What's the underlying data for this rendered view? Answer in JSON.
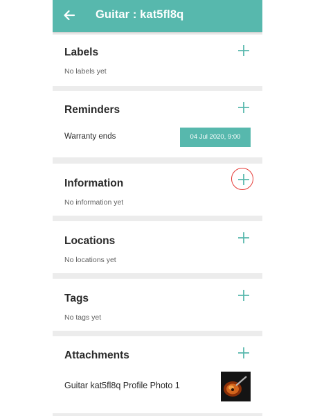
{
  "appbar": {
    "title": "Guitar : kat5fl8q",
    "back_icon": "arrow-left-icon"
  },
  "labels": {
    "title": "Labels",
    "empty": "No labels yet",
    "add_icon": "plus-icon"
  },
  "reminders": {
    "title": "Reminders",
    "add_icon": "plus-icon",
    "items": [
      {
        "label": "Warranty ends",
        "date": "04 Jul 2020, 9:00"
      }
    ]
  },
  "information": {
    "title": "Information",
    "empty": "No information yet",
    "add_icon": "plus-icon"
  },
  "locations": {
    "title": "Locations",
    "empty": "No locations yet",
    "add_icon": "plus-icon"
  },
  "tags": {
    "title": "Tags",
    "empty": "No tags yet",
    "add_icon": "plus-icon"
  },
  "attachments": {
    "title": "Attachments",
    "add_icon": "plus-icon",
    "items": [
      {
        "label": "Guitar kat5fl8q Profile Photo 1",
        "thumb_icon": "guitar-photo-thumbnail"
      }
    ]
  },
  "colors": {
    "accent": "#57b8ad",
    "highlight": "#e53935",
    "background": "#ececec"
  }
}
